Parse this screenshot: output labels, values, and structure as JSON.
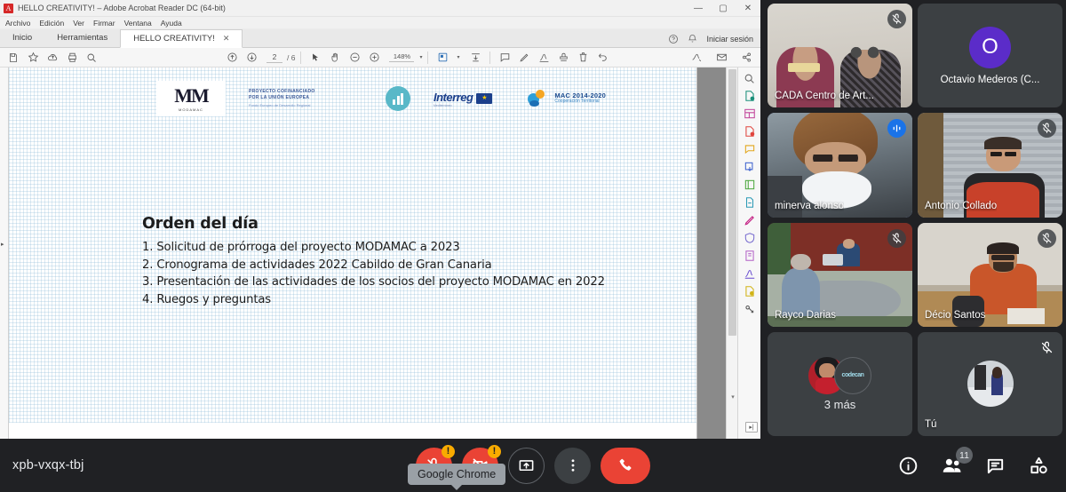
{
  "acrobat": {
    "window_title": "HELLO CREATIVITY! – Adobe Acrobat Reader DC (64-bit)",
    "window_controls": {
      "minimize": "—",
      "maximize": "▢",
      "close": "✕"
    },
    "menus": [
      "Archivo",
      "Edición",
      "Ver",
      "Firmar",
      "Ventana",
      "Ayuda"
    ],
    "tabs": [
      {
        "label": "Inicio",
        "active": false
      },
      {
        "label": "Herramientas",
        "active": false
      },
      {
        "label": "HELLO CREATIVITY!",
        "active": true,
        "close": "✕"
      }
    ],
    "signin_label": "Iniciar sesión",
    "toolbar": {
      "page_value": "2",
      "page_total": "/ 6",
      "zoom_value": "148%",
      "zoom_caret": "▾",
      "icons": [
        "save-icon",
        "star-icon",
        "upload-cloud-icon",
        "print-icon",
        "search-icon",
        "page-up-icon",
        "page-down-icon",
        "select-tool-icon",
        "hand-tool-icon",
        "zoom-out-icon",
        "zoom-in-icon",
        "fit-page-icon",
        "scroll-mode-icon",
        "comment-icon",
        "highlight-icon",
        "sign-icon",
        "stamp-icon",
        "delete-icon",
        "undo-icon",
        "signature-icon",
        "envelope-icon",
        "share-icon"
      ]
    },
    "right_tools": [
      "search-tool-icon",
      "export-pdf-icon",
      "organize-pages-icon",
      "create-pdf-icon",
      "comment-tool-icon",
      "combine-files-icon",
      "compress-pdf-icon",
      "redact-icon",
      "edit-pdf-icon",
      "protect-icon",
      "fill-and-sign-icon",
      "sign-tool-icon",
      "certificates-icon",
      "more-tools-icon"
    ],
    "rail_expand_icon": "expand-panel-icon",
    "nav_expand_icon": "expand-nav-icon"
  },
  "document": {
    "logos": {
      "modamac_mark": "MM",
      "modamac_sub": "MODAMAC",
      "eu_line1": "PROYECTO COFINANCIADO",
      "eu_line2": "POR LA UNIÓN EUROPEA",
      "eu_line3": "Fondo Europeo de Desarrollo Regional",
      "interreg": "Interreg",
      "interreg_sub": "Mediterráneo",
      "mac_line1": "MAC 2014-2020",
      "mac_line2": "Cooperación Territorial"
    },
    "heading": "Orden del día",
    "agenda_items": [
      "1. Solicitud de prórroga del proyecto MODAMAC a 2023",
      "2. Cronograma de actividades 2022 Cabildo de Gran Canaria",
      "3. Presentación de las actividades de los socios del proyecto MODAMAC en 2022",
      "4. Ruegos y preguntas"
    ]
  },
  "meet": {
    "meeting_code": "xpb-vxqx-tbj",
    "tiles": [
      {
        "name": "CADA Centro de Art...",
        "type": "video",
        "muted": true,
        "speaking": false
      },
      {
        "name": "Octavio Mederos (C...",
        "type": "avatar-initial",
        "initial": "O",
        "avatar_color": "#5b2cc9",
        "muted": false,
        "speaking": false
      },
      {
        "name": "minerva alonso",
        "type": "video",
        "muted": false,
        "speaking": true
      },
      {
        "name": "Antonio Collado",
        "type": "video",
        "muted": true,
        "speaking": false
      },
      {
        "name": "Rayco Darias",
        "type": "video",
        "muted": true,
        "speaking": false
      },
      {
        "name": "Décio Santos",
        "type": "video",
        "muted": true,
        "speaking": false
      },
      {
        "name": "3 más",
        "type": "overflow",
        "muted": false,
        "speaking": false
      },
      {
        "name": "Tú",
        "type": "avatar-photo",
        "muted": true,
        "speaking": false
      }
    ],
    "controls": {
      "mic": {
        "label_icon": "mic-off-icon",
        "state": "off",
        "warning": "!"
      },
      "camera": {
        "label_icon": "camera-off-icon",
        "state": "off",
        "warning": "!"
      },
      "present": {
        "label_icon": "present-screen-icon"
      },
      "more": {
        "label_icon": "more-options-icon"
      },
      "hangup": {
        "label_icon": "end-call-icon"
      }
    },
    "tooltip_text": "Google Chrome",
    "right_controls": [
      {
        "icon": "info-icon",
        "badge": ""
      },
      {
        "icon": "people-icon",
        "badge": "11"
      },
      {
        "icon": "chat-icon",
        "badge": ""
      },
      {
        "icon": "activities-icon",
        "badge": ""
      }
    ]
  },
  "colors": {
    "meet_bg": "#202124",
    "tile_bg": "#3c4043",
    "danger": "#ea4335",
    "warning": "#f9ab00",
    "speaking_outline": "#8ab4f8",
    "accent_blue": "#1a73e8"
  }
}
